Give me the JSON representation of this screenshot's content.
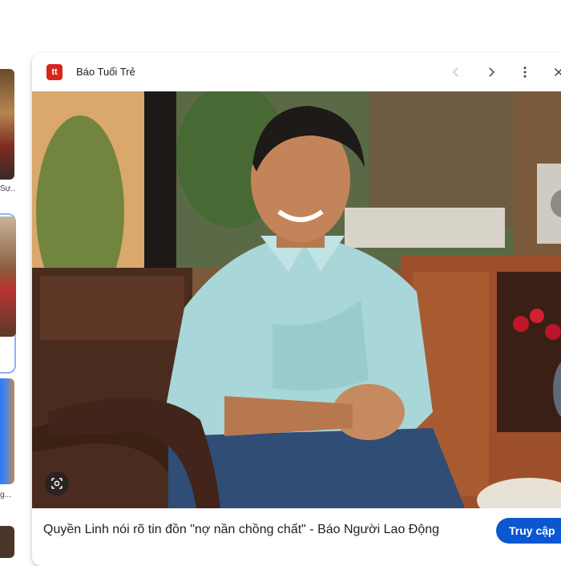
{
  "side_thumbnails": {
    "captions": [
      "Sự...",
      "g..."
    ]
  },
  "viewer": {
    "source_name": "Báo Tuổi Trẻ",
    "favicon_text": "tt",
    "caption": "Quyền Linh nói rõ tin đồn \"nợ nần chồng chất\" - Báo Người Lao Động",
    "visit_label": "Truy cập",
    "icons": {
      "prev": "chevron-left-icon",
      "next": "chevron-right-icon",
      "more": "more-vert-icon",
      "close": "close-icon",
      "lens": "lens-search-icon"
    }
  },
  "colors": {
    "accent": "#0b57d0",
    "selected_frame": "#8ab4f8",
    "favicon": "#d8261d"
  }
}
